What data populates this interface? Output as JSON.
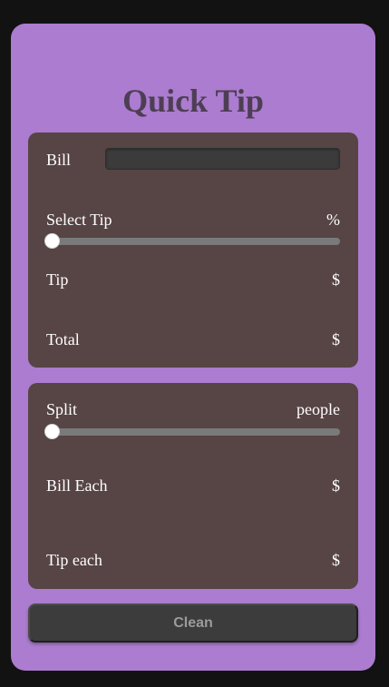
{
  "app": {
    "title": "Quick Tip"
  },
  "bill_card": {
    "bill_label": "Bill",
    "bill_value": "",
    "select_tip_label": "Select Tip",
    "tip_percent_suffix": "%",
    "tip_slider_value": 0,
    "tip_label": "Tip",
    "tip_amount": "$",
    "total_label": "Total",
    "total_amount": "$"
  },
  "split_card": {
    "split_label": "Split",
    "people_label": "people",
    "split_slider_value": 0,
    "bill_each_label": "Bill Each",
    "bill_each_amount": "$",
    "tip_each_label": "Tip each",
    "tip_each_amount": "$"
  },
  "actions": {
    "clean_label": "Clean"
  },
  "colors": {
    "page_background": "#121212",
    "app_background": "#ab7ccf",
    "card_background": "#574445",
    "title_color": "#4e3e54",
    "button_background": "#3c3c3c"
  }
}
